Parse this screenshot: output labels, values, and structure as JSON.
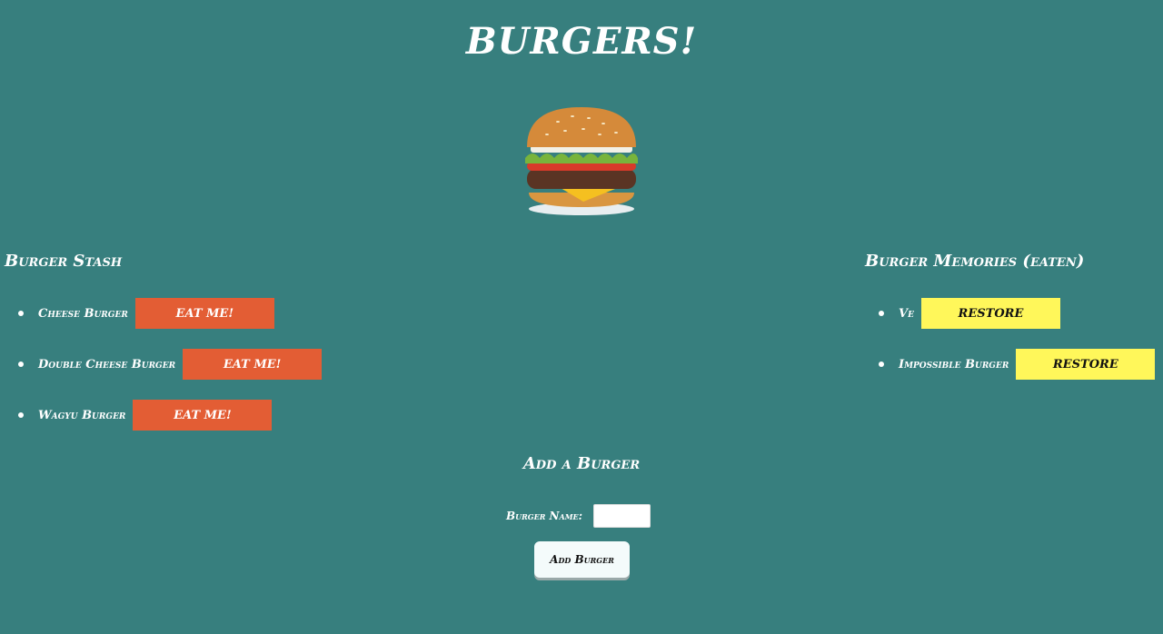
{
  "header": {
    "title": "BURGERS!"
  },
  "logo": {
    "icon": "burger-image",
    "colors": {
      "bun": "#d58a3a",
      "patty": "#5a3424",
      "lettuce": "#78b43c",
      "tomato": "#d83a2a",
      "cheese": "#f5c020"
    }
  },
  "stash": {
    "title": "Burger Stash",
    "button_label": "EAT ME!",
    "items": [
      {
        "name": "Cheese Burger"
      },
      {
        "name": "Double Cheese Burger"
      },
      {
        "name": "Wagyu Burger"
      }
    ]
  },
  "memories": {
    "title": "Burger Memories (eaten)",
    "button_label": "RESTORE",
    "items": [
      {
        "name": "Ve"
      },
      {
        "name": "Impossible Burger"
      }
    ]
  },
  "add_form": {
    "title": "Add a Burger",
    "name_label": "Burger Name:",
    "name_value": "",
    "submit_label": "Add Burger"
  },
  "colors": {
    "background": "#377f7e",
    "eat_button": "#e35d34",
    "restore_button": "#fff75a"
  }
}
